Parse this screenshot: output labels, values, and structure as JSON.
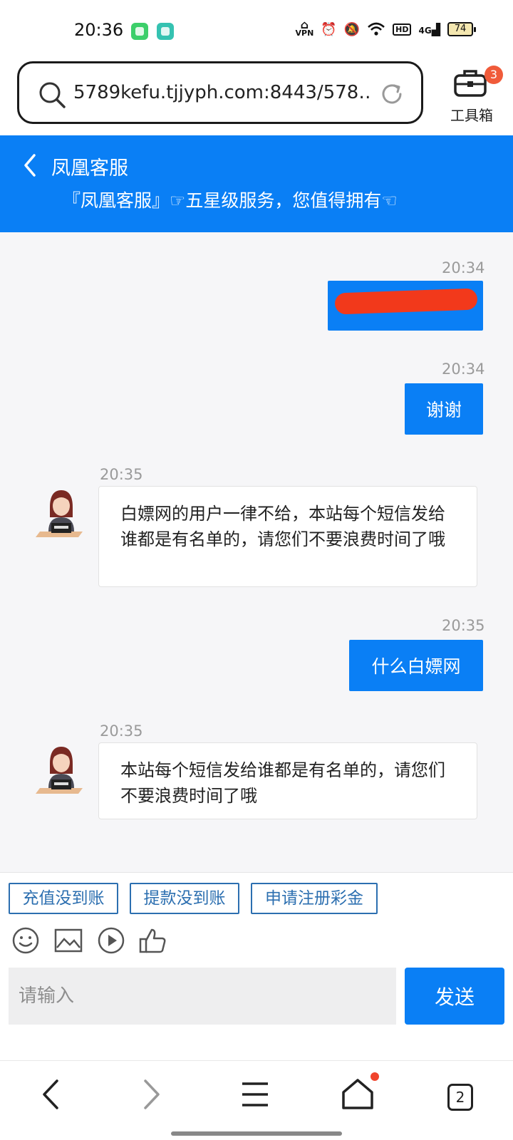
{
  "status_bar": {
    "time": "20:36",
    "network": "4G",
    "battery": "74",
    "hd": "HD",
    "vpn": "VPN"
  },
  "browser": {
    "url": "5789kefu.tjjyph.com:8443/578…",
    "toolbox_label": "工具箱",
    "toolbox_badge": "3",
    "tab_count": "2"
  },
  "header": {
    "title": "凤凰客服",
    "subtitle": "『凤凰客服』☞五星级服务，您值得拥有☜"
  },
  "messages": [
    {
      "side": "out",
      "time": "20:34",
      "text": ""
    },
    {
      "side": "out",
      "time": "20:34",
      "text": "谢谢"
    },
    {
      "side": "in",
      "time": "20:35",
      "text": "白嫖网的用户一律不给，本站每个短信发给谁都是有名单的，请您们不要浪费时间了哦"
    },
    {
      "side": "out",
      "time": "20:35",
      "text": "什么白嫖网"
    },
    {
      "side": "in",
      "time": "20:35",
      "text": "本站每个短信发给谁都是有名单的，请您们不要浪费时间了哦"
    }
  ],
  "quick_replies": [
    "充值没到账",
    "提款没到账",
    "申请注册彩金"
  ],
  "tools": [
    "emoji-icon",
    "image-icon",
    "video-icon",
    "thumbs-up-icon"
  ],
  "composer": {
    "placeholder": "请输入",
    "send_label": "发送"
  },
  "colors": {
    "accent": "#0a7ff5",
    "quick_reply_border": "#2c6fb0",
    "badge": "#f05b3a",
    "redaction": "#f2391b"
  }
}
